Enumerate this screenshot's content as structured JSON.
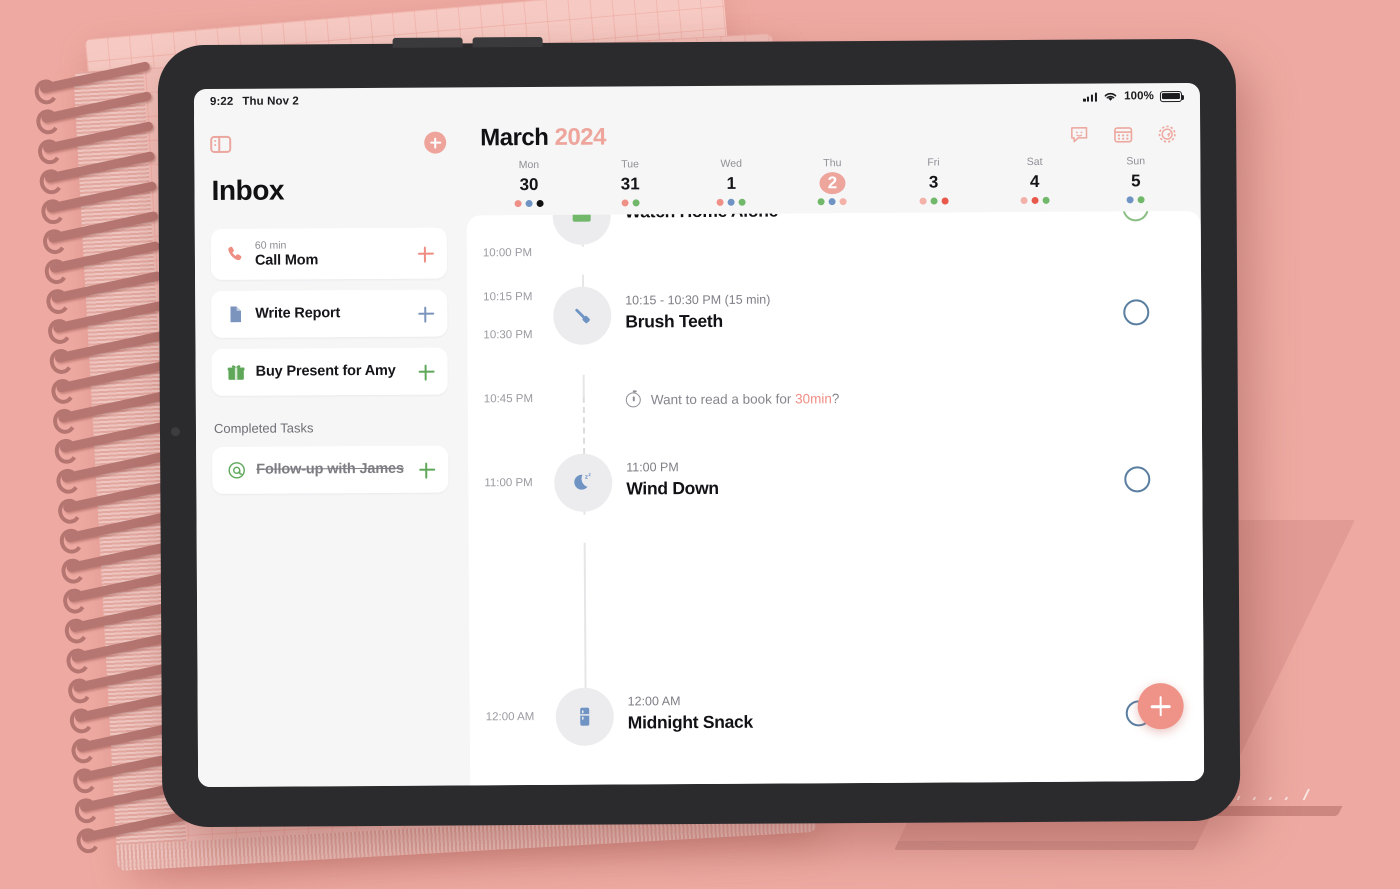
{
  "scene": {
    "background_color": "#eeaaa2",
    "board_color": "#e29c95"
  },
  "device": {
    "type": "tablet"
  },
  "statusbar": {
    "time": "9:22",
    "date": "Thu Nov 2",
    "battery_percent": "100%",
    "wifi_icon": "wifi-icon",
    "signal_icon": "cellular-signal-icon",
    "battery_icon": "battery-icon"
  },
  "sidebar": {
    "panel_toggle_icon": "sidebar-toggle-icon",
    "add_icon": "add-circle-icon",
    "title": "Inbox",
    "tasks": [
      {
        "title": "Call Mom",
        "duration": "60 min",
        "icon": "phone-icon",
        "color": "#ee8d82",
        "completed": false
      },
      {
        "title": "Write Report",
        "duration": "",
        "icon": "document-icon",
        "color": "#7b94bd",
        "completed": false
      },
      {
        "title": "Buy Present for Amy",
        "duration": "",
        "icon": "gift-icon",
        "color": "#5fa85a",
        "completed": false
      }
    ],
    "completed_label": "Completed Tasks",
    "completed_tasks": [
      {
        "title": "Follow-up with James",
        "duration": "",
        "icon": "at-sign-icon",
        "color": "#5fa85a",
        "completed": true
      }
    ]
  },
  "calendar": {
    "month": "March",
    "year": "2024",
    "header_icons": [
      {
        "name": "chat-bubble-icon"
      },
      {
        "name": "calendar-icon"
      },
      {
        "name": "settings-gear-icon"
      }
    ],
    "days": [
      {
        "dow": "Mon",
        "num": "30",
        "today": false,
        "dots": [
          "#ef9086",
          "#6f94c4",
          "#111111"
        ]
      },
      {
        "dow": "Tue",
        "num": "31",
        "today": false,
        "dots": [
          "#ef9086",
          "#71b86a"
        ]
      },
      {
        "dow": "Wed",
        "num": "1",
        "today": false,
        "dots": [
          "#ef9086",
          "#6f94c4",
          "#71b86a"
        ]
      },
      {
        "dow": "Thu",
        "num": "2",
        "today": true,
        "dots": [
          "#71b86a",
          "#6f94c4",
          "#f3b1a8"
        ]
      },
      {
        "dow": "Fri",
        "num": "3",
        "today": false,
        "dots": [
          "#f3b1a8",
          "#71b86a",
          "#e8594b"
        ]
      },
      {
        "dow": "Sat",
        "num": "4",
        "today": false,
        "dots": [
          "#f3b1a8",
          "#e8594b",
          "#71b86a"
        ]
      },
      {
        "dow": "Sun",
        "num": "5",
        "today": false,
        "dots": [
          "#6f94c4",
          "#71b86a"
        ]
      }
    ]
  },
  "timeline": {
    "time_labels": [
      "10:00 PM",
      "10:15 PM",
      "10:30 PM",
      "10:45 PM",
      "11:00 PM",
      "12:00 AM"
    ],
    "events": [
      {
        "time": "",
        "title": "Watch Home Alone",
        "icon": "movie-icon",
        "icon_color": "#71b86a",
        "check_color": "green",
        "clipped": true
      },
      {
        "time": "10:15 - 10:30 PM (15 min)",
        "title": "Brush Teeth",
        "icon": "toothbrush-icon",
        "icon_color": "#6f94c4",
        "check_color": "blue",
        "clipped": false
      },
      {
        "time": "11:00 PM",
        "title": "Wind Down",
        "icon": "moon-sleep-icon",
        "icon_color": "#6f94c4",
        "check_color": "blue",
        "clipped": false
      },
      {
        "time": "12:00 AM",
        "title": "Midnight Snack",
        "icon": "fridge-icon",
        "icon_color": "#6f94c4",
        "check_color": "blue",
        "clipped": false
      }
    ],
    "suggestion": {
      "icon": "clock-icon",
      "prefix": "Want to read a book for ",
      "highlight": "30min",
      "suffix": "?"
    },
    "fab_icon": "add-event-fab"
  }
}
